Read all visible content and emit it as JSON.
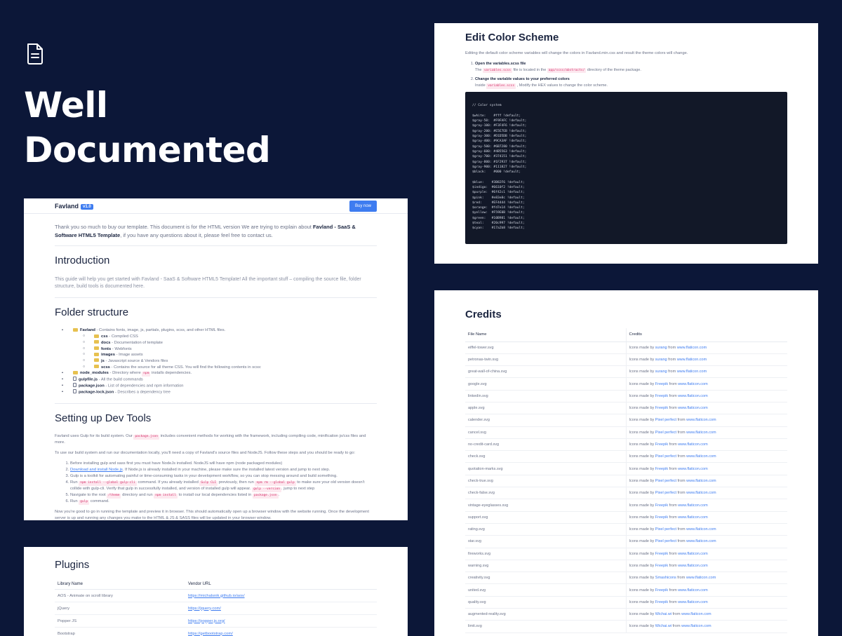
{
  "hero": {
    "icon": "document-icon",
    "title_line1": "Well",
    "title_line2": "Documented"
  },
  "doc": {
    "brand": "Favland",
    "version": "v1.0",
    "buy_label": "Buy now",
    "lead_pre": "Thank you so much to buy our template. This document is for the HTML version We are trying to explain about ",
    "lead_bold": "Favland - SaaS & Software HTML5 Template",
    "lead_post": ", if you have any questions about it, please feel free to contact us.",
    "intro_title": "Introduction",
    "intro_text": "This guide will help you get started with Favland - SaaS & Software HTML5 Template! All the important stuff – compiling the source file, folder structure, build tools is documented here.",
    "folder_title": "Folder structure",
    "tree": [
      {
        "name": "Favland",
        "desc": " - Contains fonts, image, js, partials, plugins, scss, and other HTML files.",
        "type": "folder",
        "children": [
          {
            "name": "css",
            "desc": " - Compiled CSS"
          },
          {
            "name": "docs",
            "desc": " - Documentation of template"
          },
          {
            "name": "fonts",
            "desc": " - Webfonts"
          },
          {
            "name": "images",
            "desc": " - Image assets"
          },
          {
            "name": "js",
            "desc": " - Javascript source & Vendors files"
          },
          {
            "name": "scss",
            "desc": " - Contains the source for all theme CSS. You will find the following contents in scss:"
          }
        ]
      },
      {
        "name": "node_modules",
        "desc_pre": " - Directory where ",
        "code": "npm",
        "desc_post": " installs dependencies.",
        "type": "folder"
      },
      {
        "name": "gulpfile.js",
        "desc": " - All the build commands",
        "type": "file"
      },
      {
        "name": "package.json",
        "desc": " - List of dependencies and npm information",
        "type": "file"
      },
      {
        "name": "package-lock.json",
        "desc": " - Describes a dependency tree",
        "type": "file"
      }
    ],
    "dev_title": "Setting up Dev Tools",
    "dev_p1_pre": "Favland uses Gulp for its build system. Our ",
    "dev_p1_code": "package.json",
    "dev_p1_post": " includes convenient methods for working with the framework, including compiling code, minification js/css files and more.",
    "dev_p2": "To use our build system and run our documentation locally, you'll need a copy of Favland's source files and NodeJS. Follow these steps and you should be ready to go:",
    "steps": {
      "s1": "Before installing gulp and sass first you must have NodeJs installed. NodeJS will have npm (node packaged modules)",
      "s2_link": "Download and install Node.js",
      "s2_post": ". If Node.js is already installed in your machine, please make sure the installed latest version and jump to next step.",
      "s3": "Gulp is a toolkit for automating painful or time-consuming tasks in your development workflow, so you can stop messing around and build something.",
      "s4_pre": "Run ",
      "s4_code1": "npm install --global gulp-cli",
      "s4_mid1": " command. If you already installed ",
      "s4_code2": "Gulp CLI",
      "s4_mid2": " previously, then run ",
      "s4_code3": "npm rm --global gulp",
      "s4_post": " to make sure your old version doesn't collide with gulp-cli. Verify that gulp in successfully installed, and version of installed gulp will appear. ",
      "s4_code4": "gulp --version",
      "s4_end": ". jump to next step",
      "s5_pre": "Navigate to the root ",
      "s5_code1": "/theme",
      "s5_mid": " directory and run ",
      "s5_code2": "npm install",
      "s5_post": " to install our local dependencies listed in ",
      "s5_code3": "package.json",
      "s5_end": ".",
      "s6_pre": "Run ",
      "s6_code": "gulp",
      "s6_post": " command."
    },
    "dev_p3": "Now you're good to go in running the template and preview it in browser. This should automatically open up a browser window with the website running. Once the development server is up and running any changes you make to the HTML & JS & SASS files will be updated in your browser window."
  },
  "plugins": {
    "title": "Plugins",
    "headers": [
      "Library Name",
      "Vendor URL"
    ],
    "rows": [
      [
        "AOS - Animate on scroll library",
        "https://michalsnik.github.io/aos/"
      ],
      [
        "jQuery",
        "https://jquery.com/"
      ],
      [
        "Popper JS",
        "https://popper.js.org/"
      ],
      [
        "Bootstrap",
        "https://getbootstrap.com/"
      ]
    ]
  },
  "color": {
    "title": "Edit Color Scheme",
    "intro": "Editing the default color scheme variables will change the colors in Favland.min.css and result the theme colors will change.",
    "step1_title": "Open the variables.scss file",
    "step1_pre": "The ",
    "step1_code1": "variables.scss",
    "step1_mid": " file is located in the ",
    "step1_code2": "app/scss/abstracts/",
    "step1_post": " directory of the theme package.",
    "step2_title": "Change the variable values to your preferred colors",
    "step2_pre": "Inside ",
    "step2_code": "variables.scss",
    "step2_post": " , Modify the HEX values to change the color scheme.",
    "code": "// Color system\n\n$white:    #fff !default;\n$gray-50:  #F9FAFC !default;\n$gray-100: #F3F4F6 !default;\n$gray-200: #E5E7EB !default;\n$gray-300: #D1D5DB !default;\n$gray-400: #9CA3AF !default;\n$gray-500: #6B7280 !default;\n$gray-600: #4B5563 !default;\n$gray-700: #374151 !default;\n$gray-800: #1F2937 !default;\n$gray-900: #111827 !default;\n$black:    #000 !default;\n\n$blue:    #3B82F6 !default;\n$indigo:  #6610f2 !default;\n$purple:  #6f42c1 !default;\n$pink:    #e83e8c !default;\n$red:     #EF4444 !default;\n$orange:  #fd7e14 !default;\n$yellow:  #F59E0B !default;\n$green:   #10B981 !default;\n$teal:    #20c997 !default;\n$cyan:    #17a2b8 !default;"
  },
  "credits": {
    "title": "Credits",
    "headers": [
      "File Name",
      "Credits"
    ],
    "icons_by": "Icons made by ",
    "from": " from ",
    "site": "www.flaticon.com",
    "rows": [
      [
        "eiffel-tower.svg",
        "surang"
      ],
      [
        "petronas-twin.svg",
        "surang"
      ],
      [
        "great-wall-of-china.svg",
        "surang"
      ],
      [
        "google.svg",
        "Freepik"
      ],
      [
        "linkedin.svg",
        "Freepik"
      ],
      [
        "apple.svg",
        "Freepik"
      ],
      [
        "calender.svg",
        "Pixel perfect"
      ],
      [
        "cancel.svg",
        "Pixel perfect"
      ],
      [
        "no-credit-card.svg",
        "Freepik"
      ],
      [
        "check.svg",
        "Pixel perfect"
      ],
      [
        "quotation-marks.svg",
        "Freepik"
      ],
      [
        "check-true.svg",
        "Pixel perfect"
      ],
      [
        "check-false.svg",
        "Pixel perfect"
      ],
      [
        "vintage-eyeglasses.svg",
        "Freepik"
      ],
      [
        "support.svg",
        "Freepik"
      ],
      [
        "rating.svg",
        "Pixel perfect"
      ],
      [
        "star.svg",
        "Pixel perfect"
      ],
      [
        "fireworks.svg",
        "Freepik"
      ],
      [
        "warning.svg",
        "Freepik"
      ],
      [
        "creativity.svg",
        "Smashicons"
      ],
      [
        "united.svg",
        "Freepik"
      ],
      [
        "quality.svg",
        "Freepik"
      ],
      [
        "augmented-reality.svg",
        "Wichai.wi"
      ],
      [
        "limit.svg",
        "Wichai.wi"
      ]
    ]
  },
  "colors": {
    "background": "#0c1738",
    "accent": "#3e7cf0",
    "code_bg": "#121828"
  }
}
